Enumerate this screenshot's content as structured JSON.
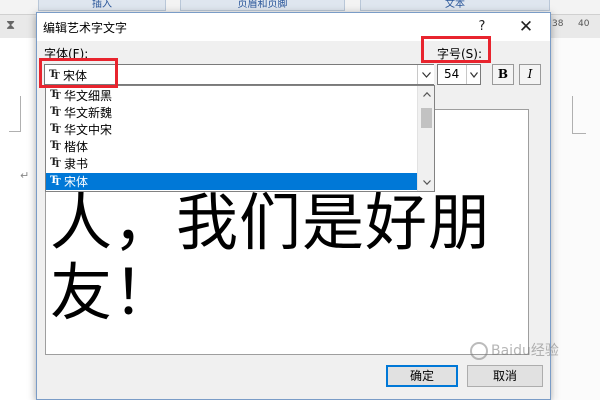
{
  "background": {
    "ribbon_tabs": [
      "插入",
      "页眉和页脚",
      "文本"
    ],
    "ruler_numbers": [
      "38",
      "40"
    ],
    "paragraph_mark": "↵"
  },
  "dialog": {
    "title": "编辑艺术字文字",
    "help_label": "?",
    "close_label": "✕",
    "font_label": "字体(F):",
    "size_label": "字号(S):",
    "font_value": "宋体",
    "size_value": "54",
    "bold_label": "B",
    "italic_label": "I",
    "font_list": [
      {
        "label": "华文细黑",
        "selected": false
      },
      {
        "label": "华文新魏",
        "selected": false
      },
      {
        "label": "华文中宋",
        "selected": false
      },
      {
        "label": "楷体",
        "selected": false
      },
      {
        "label": "隶书",
        "selected": false
      },
      {
        "label": "宋体",
        "selected": true
      }
    ],
    "preview_text": "人，我们是好朋友！",
    "ok_label": "确定",
    "cancel_label": "取消"
  },
  "annotation_color": "#e8242e",
  "selection_color": "#0078d7",
  "watermark": "Baidu经验"
}
